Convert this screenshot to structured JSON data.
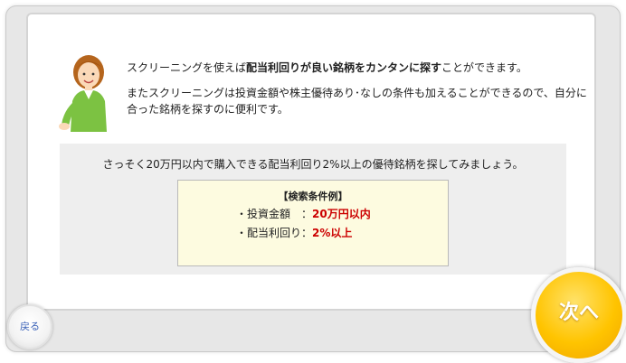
{
  "intro": {
    "line1_pre": "スクリーニングを使えば",
    "line1_bold": "配当利回りが良い銘柄をカンタンに探す",
    "line1_post": "ことができます。",
    "line2": "またスクリーニングは投資金額や株主優待あり･なしの条件も加えることができるので、自分に合った銘柄を探すのに便利です。"
  },
  "panel": {
    "lead": "さっそく20万円以内で購入できる配当利回り2%以上の優待銘柄を探してみましょう。",
    "conditions_title": "【検索条件例】",
    "conditions": [
      {
        "label": "・投資金額　：",
        "value": "20万円以内"
      },
      {
        "label": "・配当利回り：",
        "value": "2%以上"
      }
    ]
  },
  "nav": {
    "back_label": "戻る",
    "next_label": "次へ"
  },
  "colors": {
    "accent_value": "#cc0000",
    "next_button": "#ffc400",
    "back_text": "#3c63b8"
  },
  "icons": {
    "assistant": "woman-assistant-avatar"
  }
}
